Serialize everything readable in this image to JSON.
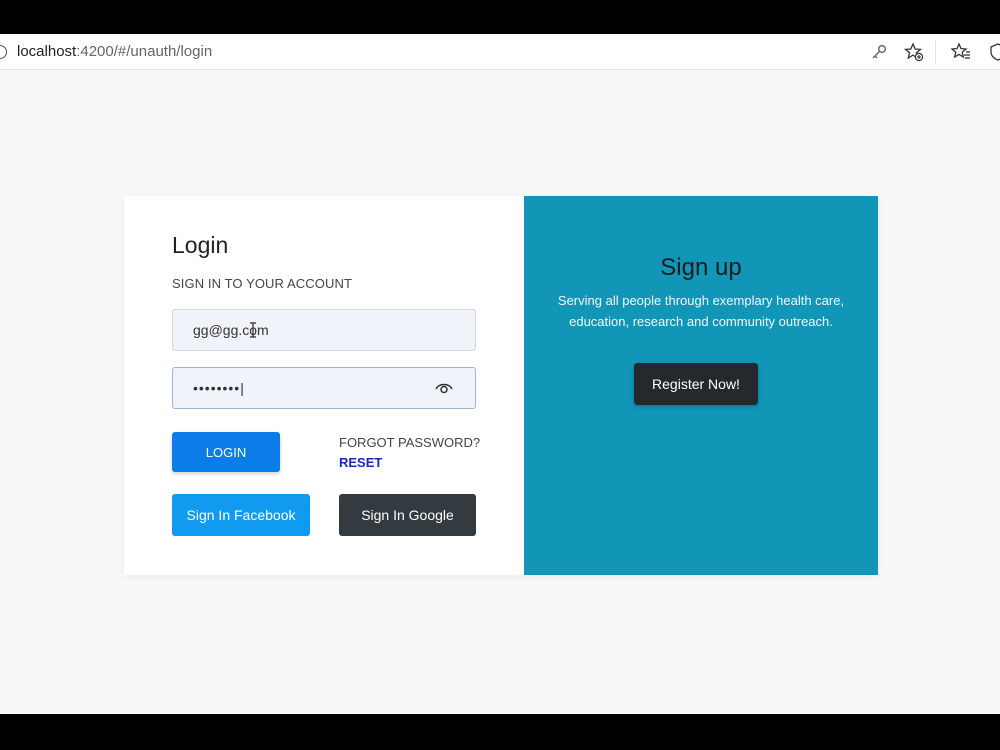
{
  "browser": {
    "url_host": "localhost",
    "url_rest": ":4200/#/unauth/login"
  },
  "login": {
    "title": "Login",
    "subtitle": "SIGN IN TO YOUR ACCOUNT",
    "email_value": "gg@gg.com",
    "password_value": "••••••••|",
    "login_button": "LOGIN",
    "forgot_text": "FORGOT PASSWORD?",
    "reset_link": "RESET",
    "facebook_button": "Sign In Facebook",
    "google_button": "Sign In Google"
  },
  "signup": {
    "title": "Sign up",
    "description": "Serving all people through exemplary health care, education, research and community outreach.",
    "register_button": "Register Now!"
  },
  "colors": {
    "signup_panel": "#1196b8",
    "login_button": "#0a7de8",
    "facebook_button": "#119bf0",
    "google_button": "#343b40",
    "register_button": "#23292d",
    "reset_link": "#1a2ab8"
  },
  "icons": [
    "info-icon",
    "key-icon",
    "star-add-icon",
    "favorites-icon",
    "shield-icon",
    "eye-icon",
    "text-cursor-icon"
  ]
}
